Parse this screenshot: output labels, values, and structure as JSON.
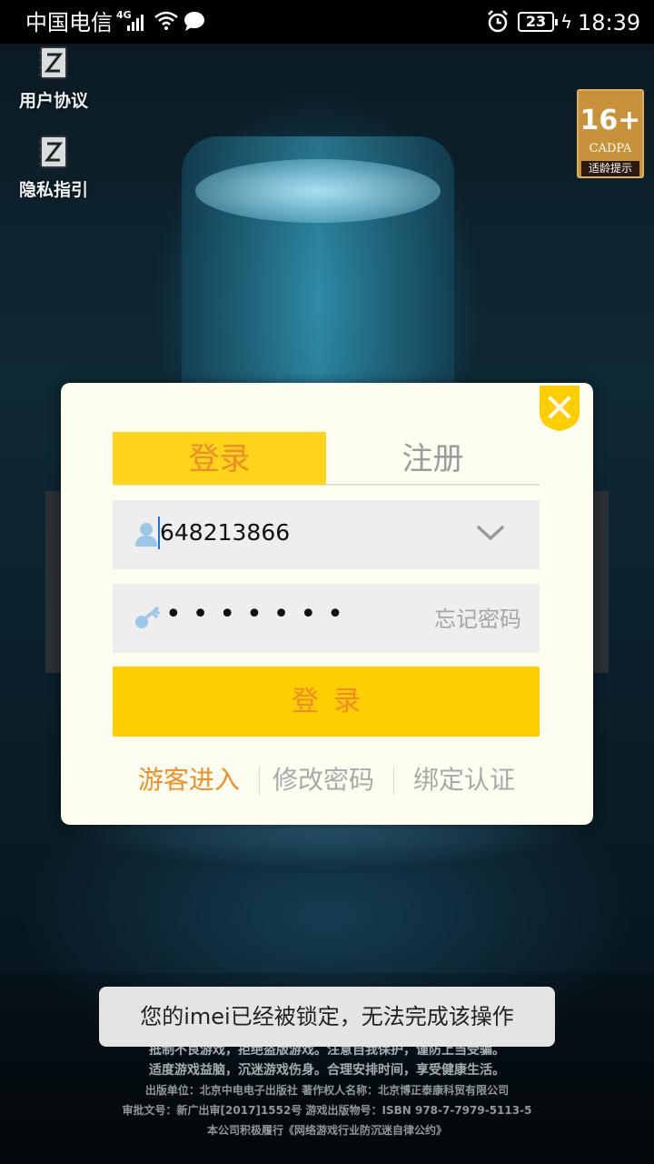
{
  "status_bar": {
    "carrier": "中国电信",
    "network": "4G",
    "battery": "23",
    "time": "18:39"
  },
  "side_links": {
    "agreement": "用户协议",
    "privacy": "隐私指引"
  },
  "age_rating": {
    "age": "16+",
    "org": "CADPA",
    "tip": "适龄提示"
  },
  "dialog": {
    "tabs": {
      "login": "登录",
      "register": "注册"
    },
    "account": {
      "value": "648213866"
    },
    "password": {
      "masked": "•••••••",
      "forgot": "忘记密码"
    },
    "login_button": "登录",
    "links": {
      "guest": "游客进入",
      "change_password": "修改密码",
      "bind": "绑定认证"
    }
  },
  "toast": "您的imei已经被锁定，无法完成该操作",
  "footer": {
    "line1": "抵制不良游戏，拒绝盗版游戏。注意自我保护，谨防上当受骗。",
    "line2": "适度游戏益脑，沉迷游戏伤身。合理安排时间，享受健康生活。",
    "publisher": "出版单位：北京中电电子出版社  著作权人名称：北京博正泰康科贸有限公司",
    "approval": "审批文号：新广出审[2017]1552号  游戏出版物号：ISBN 978-7-7979-5113-5",
    "pledge": "本公司积极履行《网络游戏行业防沉迷自律公约》"
  },
  "colors": {
    "accent_yellow": "#ffce00",
    "accent_orange": "#ef8f29",
    "dialog_bg": "#fdfdf0"
  }
}
